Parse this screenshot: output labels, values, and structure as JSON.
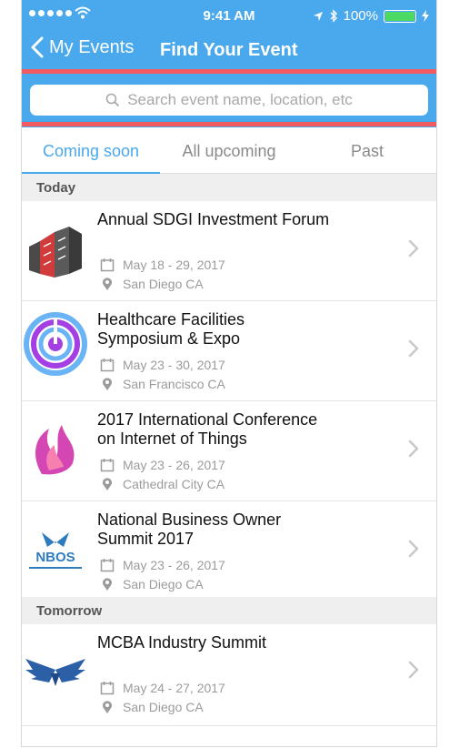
{
  "status_bar": {
    "time": "9:41 AM",
    "battery": "100%"
  },
  "nav": {
    "back_label": "My Events",
    "title": "Find Your Event"
  },
  "search": {
    "placeholder": "Search event name, location, etc"
  },
  "tabs": [
    {
      "label": "Coming soon",
      "active": true
    },
    {
      "label": "All upcoming",
      "active": false
    },
    {
      "label": "Past",
      "active": false
    }
  ],
  "sections": [
    {
      "title": "Today",
      "events": [
        {
          "title": "Annual SDGI Investment Forum",
          "dates": "May 18 - 29, 2017",
          "location": "San Diego CA",
          "logo": "sdgi-building-logo"
        },
        {
          "title": "Healthcare Facilities Symposium & Expo",
          "dates": "May 23 - 30, 2017",
          "location": "San Francisco CA",
          "logo": "healthcare-circle-logo"
        },
        {
          "title": "2017 International Conference on Internet of Things",
          "dates": "May 23 - 26, 2017",
          "location": "Cathedral City CA",
          "logo": "iot-flame-logo"
        },
        {
          "title": "National Business Owner Summit 2017",
          "dates": "May 23 - 26, 2017",
          "location": "San Diego CA",
          "logo": "nbos-logo",
          "logo_text": "NBOS"
        }
      ]
    },
    {
      "title": "Tomorrow",
      "events": [
        {
          "title": "MCBA Industry Summit",
          "dates": "May 24 - 27, 2017",
          "location": "San Diego CA",
          "logo": "mcba-wings-logo"
        }
      ]
    }
  ],
  "colors": {
    "accent": "#4aa8ec",
    "highlight": "#f35b62"
  }
}
